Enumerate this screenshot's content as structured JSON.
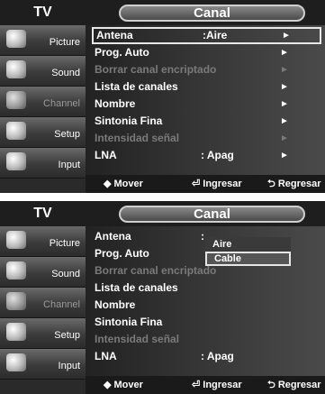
{
  "screen1": {
    "tv_label": "TV",
    "title": "Canal",
    "sidebar": [
      {
        "label": "Picture",
        "icon": "picture-icon"
      },
      {
        "label": "Sound",
        "icon": "sound-icon"
      },
      {
        "label": "Channel",
        "icon": "channel-icon"
      },
      {
        "label": "Setup",
        "icon": "setup-icon"
      },
      {
        "label": "Input",
        "icon": "input-icon"
      }
    ],
    "menu": [
      {
        "label": "Antena",
        "value": ":Aire",
        "arrow": "►"
      },
      {
        "label": "Prog. Auto",
        "value": "",
        "arrow": "►"
      },
      {
        "label": "Borrar canal encriptado",
        "value": "",
        "arrow": "►"
      },
      {
        "label": "Lista de canales",
        "value": "",
        "arrow": "►"
      },
      {
        "label": "Nombre",
        "value": "",
        "arrow": "►"
      },
      {
        "label": "Sintonia Fina",
        "value": "",
        "arrow": "►"
      },
      {
        "label": "Intensidad señal",
        "value": "",
        "arrow": "►"
      },
      {
        "label": "LNA",
        "value": ": Apag",
        "arrow": "►"
      }
    ],
    "hints": {
      "move": "◆ Mover",
      "enter": "⏎ Ingresar",
      "return": "⮌ Regresar"
    }
  },
  "screen2": {
    "tv_label": "TV",
    "title": "Canal",
    "sidebar": [
      {
        "label": "Picture",
        "icon": "picture-icon"
      },
      {
        "label": "Sound",
        "icon": "sound-icon"
      },
      {
        "label": "Channel",
        "icon": "channel-icon"
      },
      {
        "label": "Setup",
        "icon": "setup-icon"
      },
      {
        "label": "Input",
        "icon": "input-icon"
      }
    ],
    "menu": [
      {
        "label": "Antena",
        "value": ":",
        "arrow": ""
      },
      {
        "label": "Prog. Auto",
        "value": "",
        "arrow": ""
      },
      {
        "label": "Borrar canal encriptado",
        "value": "",
        "arrow": ""
      },
      {
        "label": "Lista de canales",
        "value": "",
        "arrow": ""
      },
      {
        "label": "Nombre",
        "value": "",
        "arrow": ""
      },
      {
        "label": "Sintonia Fina",
        "value": "",
        "arrow": ""
      },
      {
        "label": "Intensidad señal",
        "value": "",
        "arrow": ""
      },
      {
        "label": "LNA",
        "value": ": Apag",
        "arrow": ""
      }
    ],
    "dropdown": [
      "Aire",
      "Cable"
    ],
    "hints": {
      "move": "◆ Mover",
      "enter": "⏎ Ingresar",
      "return": "⮌ Regresar"
    }
  }
}
